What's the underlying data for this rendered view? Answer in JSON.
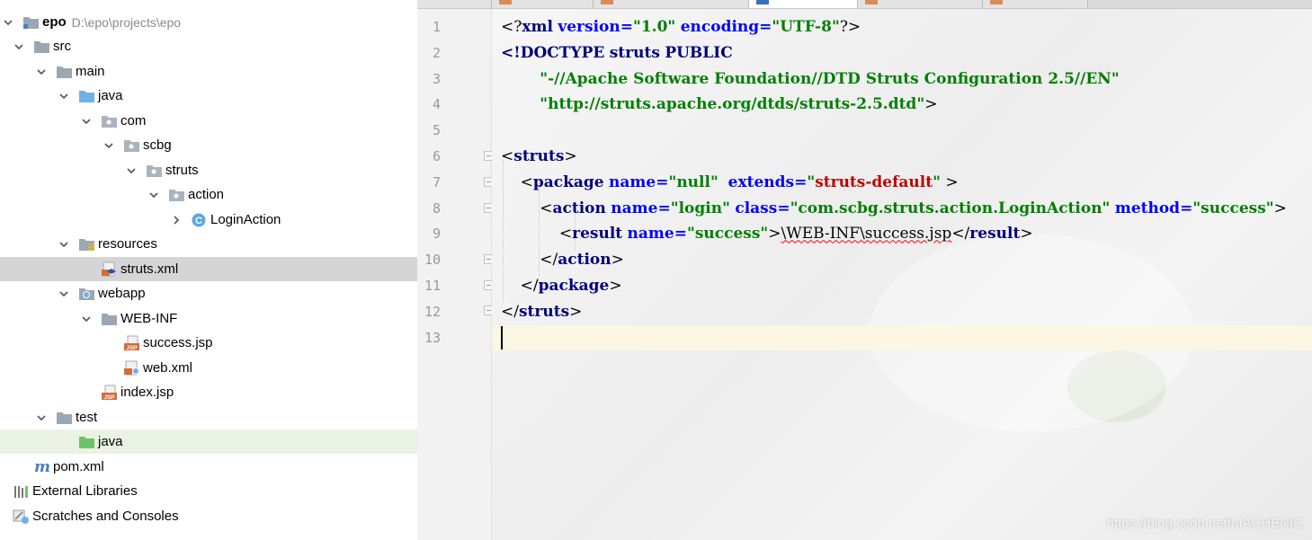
{
  "project": {
    "root_name": "epo",
    "root_path": "D:\\epo\\projects\\epo",
    "items": [
      {
        "label": "src",
        "icon": "folder-icon"
      },
      {
        "label": "main",
        "icon": "folder-icon"
      },
      {
        "label": "java",
        "icon": "source-folder-icon"
      },
      {
        "label": "com",
        "icon": "package-icon"
      },
      {
        "label": "scbg",
        "icon": "package-icon"
      },
      {
        "label": "struts",
        "icon": "package-icon"
      },
      {
        "label": "action",
        "icon": "package-icon"
      },
      {
        "label": "LoginAction",
        "icon": "class-icon"
      },
      {
        "label": "resources",
        "icon": "resources-folder-icon"
      },
      {
        "label": "struts.xml",
        "icon": "xml-file-icon"
      },
      {
        "label": "webapp",
        "icon": "web-folder-icon"
      },
      {
        "label": "WEB-INF",
        "icon": "folder-icon"
      },
      {
        "label": "success.jsp",
        "icon": "jsp-file-icon"
      },
      {
        "label": "web.xml",
        "icon": "xml-file-icon"
      },
      {
        "label": "index.jsp",
        "icon": "jsp-file-icon"
      },
      {
        "label": "test",
        "icon": "folder-icon"
      },
      {
        "label": "java",
        "icon": "test-source-folder-icon"
      },
      {
        "label": "pom.xml",
        "icon": "maven-icon"
      },
      {
        "label": "External Libraries",
        "icon": "library-icon"
      },
      {
        "label": "Scratches and Consoles",
        "icon": "scratches-icon"
      }
    ]
  },
  "editor": {
    "line_numbers": [
      "1",
      "2",
      "3",
      "4",
      "5",
      "6",
      "7",
      "8",
      "9",
      "10",
      "11",
      "12",
      "13"
    ],
    "code": {
      "l1": {
        "open": "<?",
        "tag": "xml",
        "a1": "version",
        "eq1": "=",
        "v1": "\"1.0\"",
        "a2": "encoding",
        "eq2": "=",
        "v2": "\"UTF-8\"",
        "close": "?>"
      },
      "l2": {
        "doctype": "<!DOCTYPE",
        "s1": "struts",
        "s2": "PUBLIC"
      },
      "l3": {
        "text": "\"-//Apache Software Foundation//DTD Struts Configuration 2.5//EN\""
      },
      "l4": {
        "text": "\"http://struts.apache.org/dtds/struts-2.5.dtd\"",
        "close": ">"
      },
      "l6": {
        "open": "<",
        "tag": "struts",
        "close": ">"
      },
      "l7": {
        "open": "<",
        "tag": "package",
        "a1": "name",
        "eq1": "=",
        "v1": "\"null\"",
        "a2": "extends",
        "eq2": "=",
        "v2a": "\"",
        "v2b": "struts-default",
        "v2c": "\"",
        "close": " >"
      },
      "l8": {
        "open": "<",
        "tag": "action",
        "a1": "name",
        "eq1": "=",
        "v1": "\"login\"",
        "a2": "class",
        "eq2": "=",
        "v2": "\"com.scbg.struts.action.LoginAction\"",
        "a3": "method",
        "eq3": "=",
        "v3": "\"success\"",
        "close": ">"
      },
      "l9": {
        "open": "<",
        "tag": "result",
        "a1": "name",
        "eq1": "=",
        "v1": "\"success\"",
        "close": ">",
        "text": "\\WEB-INF\\success.jsp",
        "copen": "</",
        "ctag": "result",
        "cclose": ">"
      },
      "l10": {
        "open": "</",
        "tag": "action",
        "close": ">"
      },
      "l11": {
        "open": "</",
        "tag": "package",
        "close": ">"
      },
      "l12": {
        "open": "</",
        "tag": "struts",
        "close": ">"
      }
    }
  },
  "watermark": "https://blog.csdn.net/MACHENIC"
}
